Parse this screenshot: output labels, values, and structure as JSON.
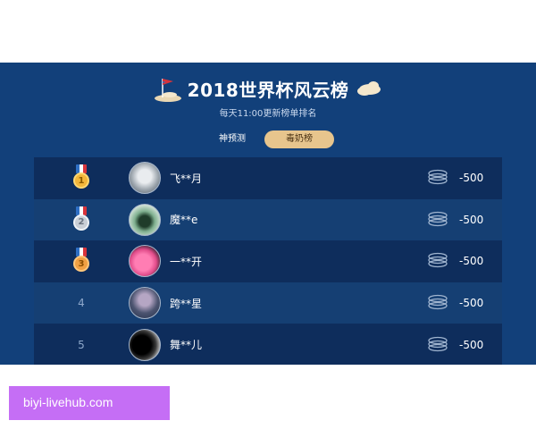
{
  "header": {
    "title": "2018世界杯风云榜",
    "subtitle": "每天11:00更新榜单排名"
  },
  "tabs": [
    {
      "label": "神预测",
      "active": false
    },
    {
      "label": "毒奶榜",
      "active": true
    }
  ],
  "rows": [
    {
      "rank": "1",
      "medal": "gold",
      "name": "飞**月",
      "score": "-500",
      "coin_icon": "coin-stack-icon"
    },
    {
      "rank": "2",
      "medal": "silver",
      "name": "魔**e",
      "score": "-500",
      "coin_icon": "coin-stack-icon"
    },
    {
      "rank": "3",
      "medal": "bronze",
      "name": "一**开",
      "score": "-500",
      "coin_icon": "coin-stack-icon"
    },
    {
      "rank": "4",
      "medal": "",
      "name": "跨**星",
      "score": "-500",
      "coin_icon": "coin-stack-icon"
    },
    {
      "rank": "5",
      "medal": "",
      "name": "舞**儿",
      "score": "-500",
      "coin_icon": "coin-stack-icon"
    }
  ],
  "watermark": {
    "text": "biyi-livehub.com"
  },
  "colors": {
    "board_bg": "#12407a",
    "row_dark": "#0e2d5c",
    "row_light": "#153f73",
    "active_tab": "#e7c58d"
  }
}
